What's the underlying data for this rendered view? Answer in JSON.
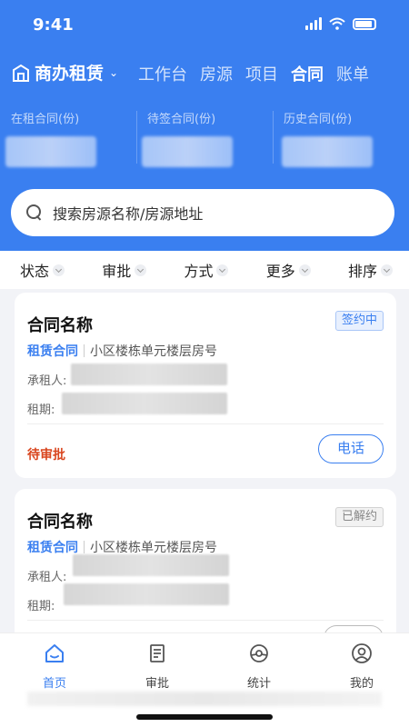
{
  "status_bar": {
    "time": "9:41"
  },
  "header": {
    "brand": "商办租赁",
    "tabs": [
      {
        "label": "工作台",
        "active": false
      },
      {
        "label": "房源",
        "active": false
      },
      {
        "label": "项目",
        "active": false
      },
      {
        "label": "合同",
        "active": true
      },
      {
        "label": "账单",
        "active": false
      }
    ]
  },
  "stats": [
    {
      "label": "在租合同(份)"
    },
    {
      "label": "待签合同(份)"
    },
    {
      "label": "历史合同(份)"
    }
  ],
  "search": {
    "placeholder": "搜索房源名称/房源地址"
  },
  "filters": [
    "状态",
    "审批",
    "方式",
    "更多",
    "排序"
  ],
  "contracts": [
    {
      "title": "合同名称",
      "badge": "签约中",
      "type": "租赁合同",
      "address": "小区楼栋单元楼层房号",
      "tenant_label": "承租人:",
      "period_label": "租期:",
      "status": "待审批",
      "action": "电话"
    },
    {
      "title": "合同名称",
      "badge": "已解约",
      "type": "租赁合同",
      "address": "小区楼栋单元楼层房号",
      "tenant_label": "承租人:",
      "period_label": "租期:"
    }
  ],
  "tabbar": [
    {
      "label": "首页",
      "icon": "home-icon",
      "active": true
    },
    {
      "label": "审批",
      "icon": "document-icon",
      "active": false
    },
    {
      "label": "统计",
      "icon": "chart-icon",
      "active": false
    },
    {
      "label": "我的",
      "icon": "user-icon",
      "active": false
    }
  ],
  "colors": {
    "primary": "#3a7ff0",
    "pending": "#d9461f"
  }
}
